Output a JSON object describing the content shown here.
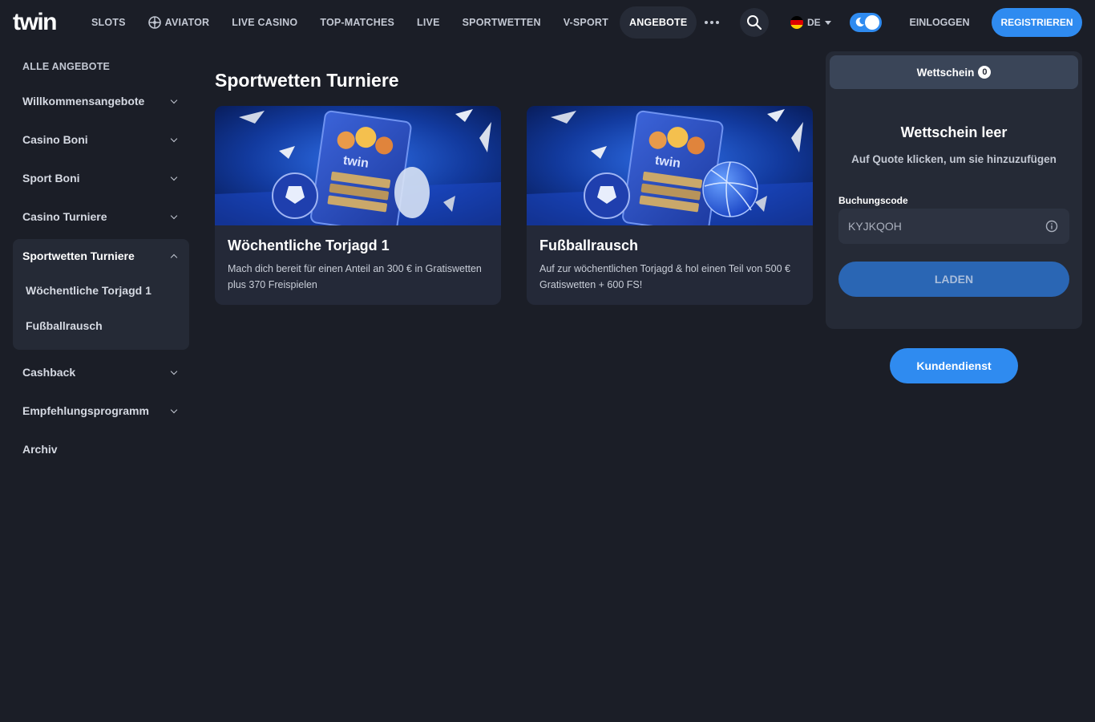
{
  "header": {
    "logo_text": "twin",
    "nav": [
      {
        "label": "SLOTS",
        "active": false
      },
      {
        "label": "AVIATOR",
        "active": false,
        "icon": "aviator-icon"
      },
      {
        "label": "LIVE CASINO",
        "active": false
      },
      {
        "label": "TOP-MATCHES",
        "active": false
      },
      {
        "label": "LIVE",
        "active": false
      },
      {
        "label": "SPORTWETTEN",
        "active": false
      },
      {
        "label": "V-SPORT",
        "active": false
      },
      {
        "label": "ANGEBOTE",
        "active": true
      }
    ],
    "more_icon": "more-dots-icon",
    "search_icon": "search-icon",
    "language": "DE",
    "flag": "germany-flag-icon",
    "theme_toggle_icon": "moon-icon",
    "login_label": "EINLOGGEN",
    "register_label": "REGISTRIEREN"
  },
  "sidebar": {
    "heading": "ALLE ANGEBOTE",
    "items_top": [
      {
        "label": "Willkommensangebote"
      },
      {
        "label": "Casino Boni"
      },
      {
        "label": "Sport Boni"
      },
      {
        "label": "Casino Turniere"
      }
    ],
    "expanded": {
      "label": "Sportwetten Turniere",
      "children": [
        "Wöchentliche Torjagd 1",
        "Fußballrausch"
      ]
    },
    "items_bottom": [
      {
        "label": "Cashback"
      },
      {
        "label": "Empfehlungsprogramm"
      },
      {
        "label": "Archiv"
      }
    ]
  },
  "main": {
    "title": "Sportwetten Turniere",
    "cards": [
      {
        "title": "Wöchentliche Torjagd 1",
        "description": "Mach dich bereit für einen Anteil an 300 € in Gratiswetten plus 370 Freispielen",
        "image_logo": "twin"
      },
      {
        "title": "Fußballrausch",
        "description": "Auf zur wöchentlichen Torjagd & hol einen Teil von 500 € Gratiswetten + 600 FS!",
        "image_logo": "twin"
      }
    ]
  },
  "betslip": {
    "tab_label": "Wettschein",
    "count": "0",
    "empty_title": "Wettschein leer",
    "empty_subtitle": "Auf Quote klicken, um sie hinzuzufügen",
    "code_label": "Buchungscode",
    "code_value": "KYJKQOH",
    "load_label": "LADEN"
  },
  "support_label": "Kundendienst",
  "colors": {
    "background": "#1b1e27",
    "panel": "#252a36",
    "accent": "#2f8bf0",
    "load_button": "#2a66b4"
  }
}
